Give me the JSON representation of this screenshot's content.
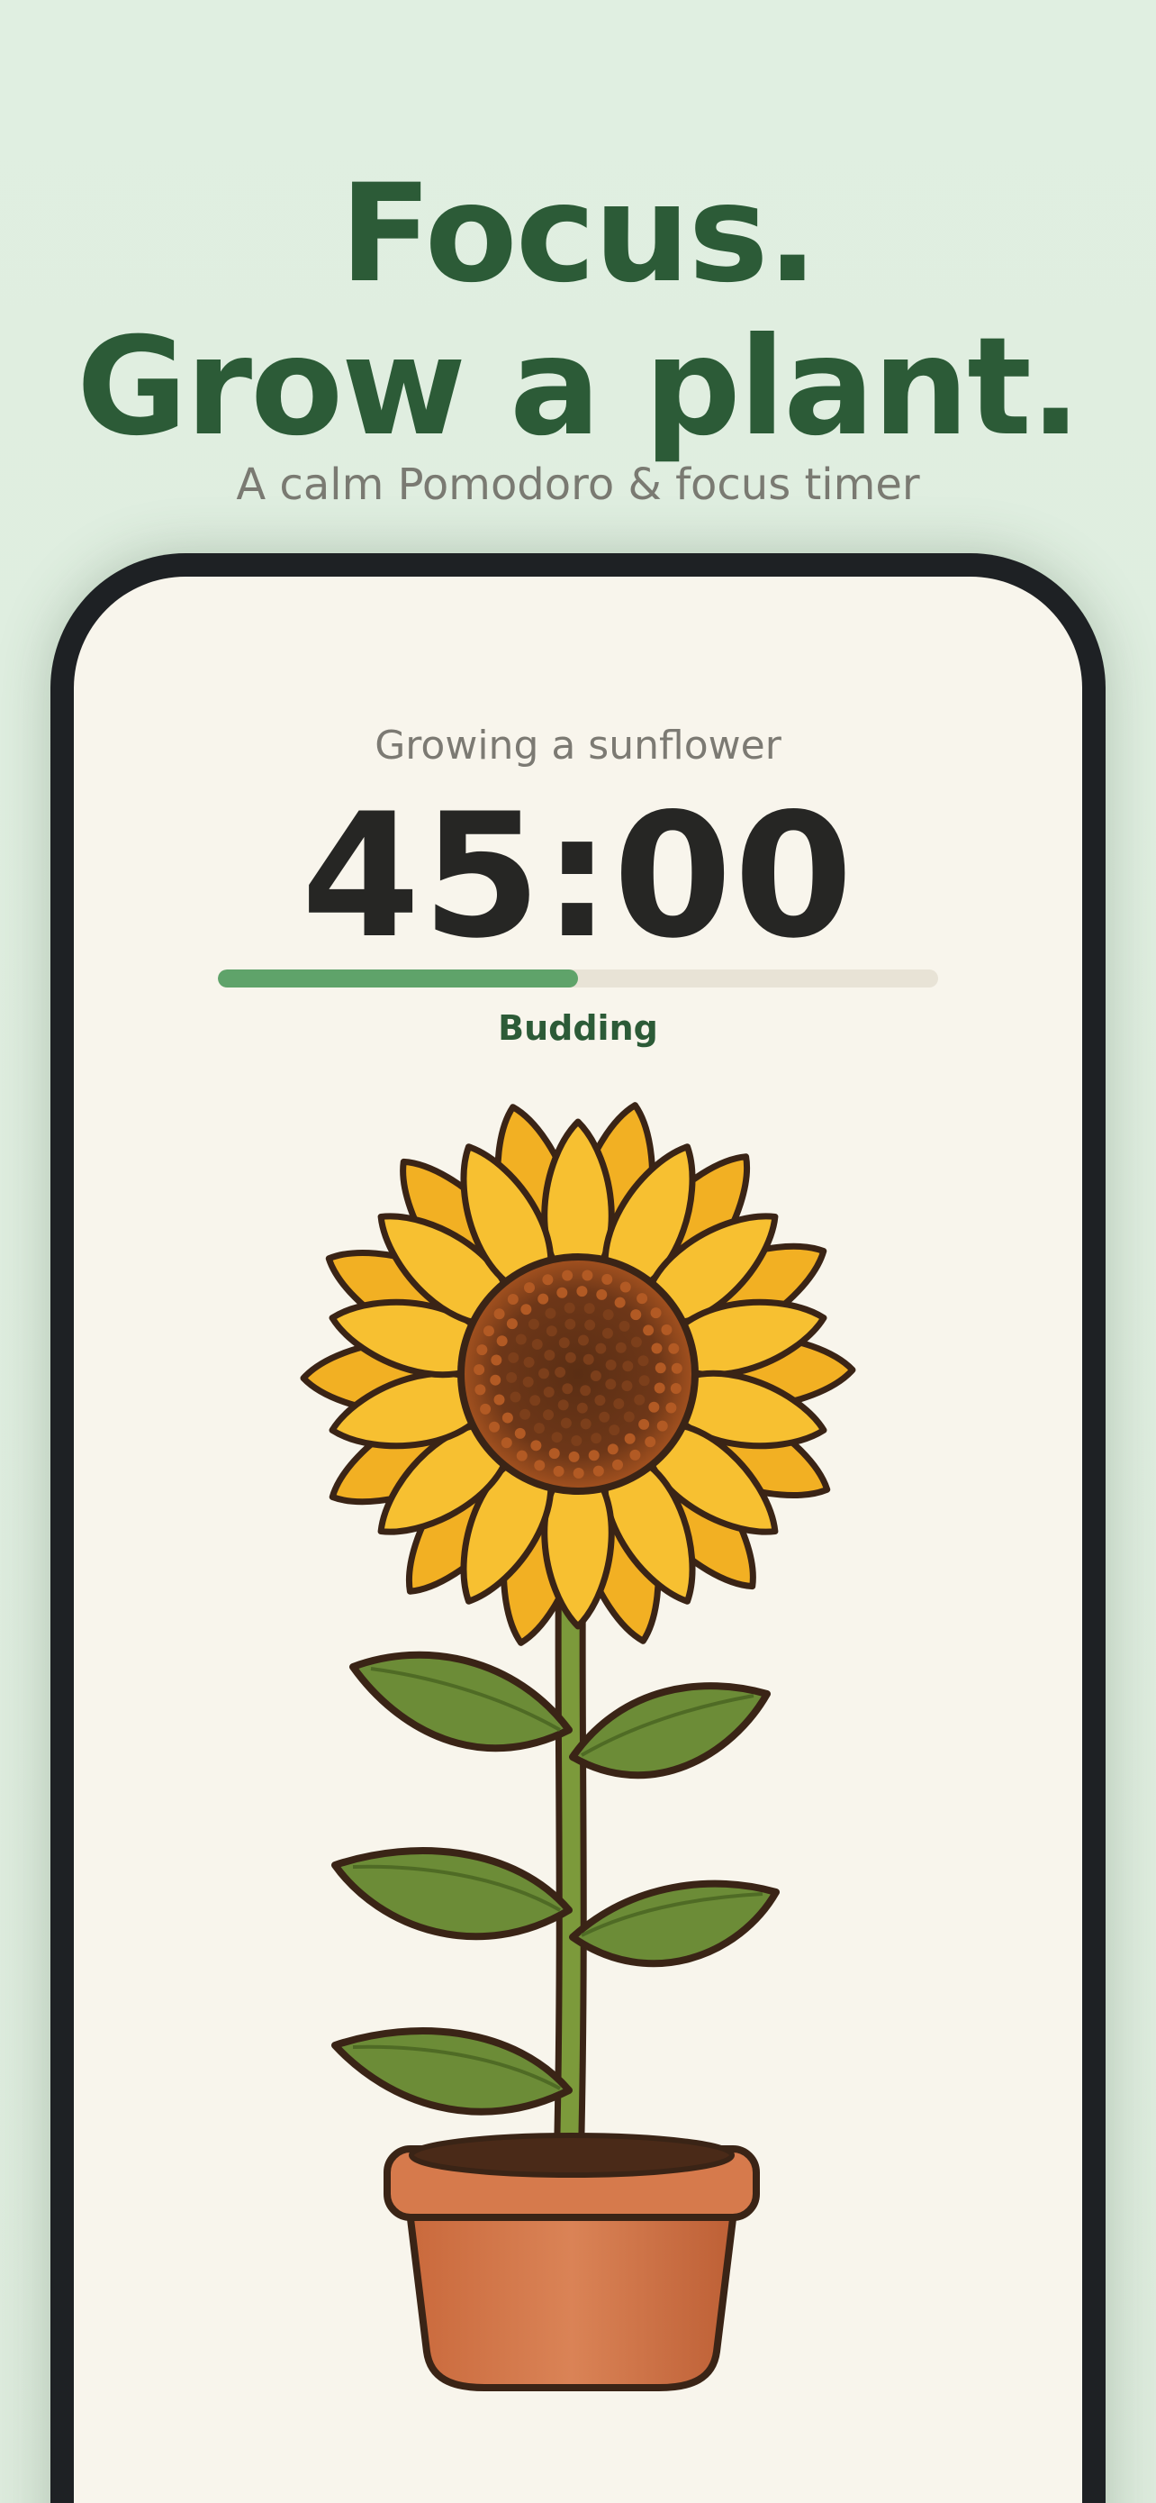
{
  "hero": {
    "line1": "Focus.",
    "line2": "Grow a plant.",
    "tagline": "A calm Pomodoro & focus timer"
  },
  "timer_screen": {
    "plant_status": "Growing a sunflower",
    "time_remaining": "45:00",
    "progress": 0.5,
    "stage_label": "Budding",
    "plant_illustration": "sunflower-in-pot"
  },
  "colors": {
    "heading": "#2c5b37",
    "background": "#dfeee0",
    "screen": "#f8f5ec",
    "progress_fill": "#5fa36a",
    "progress_track": "#e8e3d6",
    "petal": "#f7c031",
    "leaf": "#6c8c37",
    "pot": "#c96d3f"
  }
}
